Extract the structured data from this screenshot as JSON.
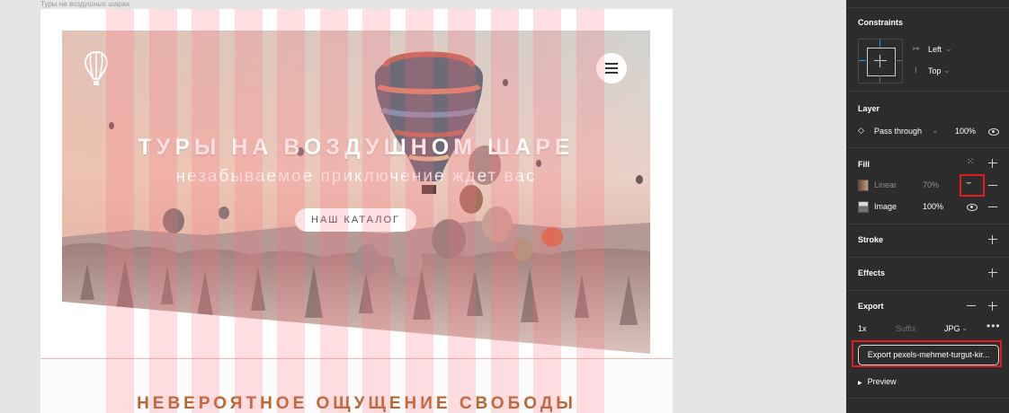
{
  "canvas": {
    "frame_label": "Туры на воздушных шарах",
    "hero": {
      "title": "ТУРЫ НА ВОЗДУШНОМ ШАРЕ",
      "subtitle": "незабываемое приключение ждет вас",
      "button_label": "НАШ КАТАЛОГ"
    },
    "section_title": "НЕВЕРОЯТНОЕ ОЩУЩЕНИЕ СВОБОДЫ",
    "grid_columns": 12
  },
  "panel": {
    "constraints": {
      "title": "Constraints",
      "horizontal": "Left",
      "vertical": "Top"
    },
    "layer": {
      "title": "Layer",
      "blend_mode": "Pass through",
      "opacity": "100%"
    },
    "fill": {
      "title": "Fill",
      "items": [
        {
          "type": "Linear",
          "opacity": "70%"
        },
        {
          "type": "Image",
          "opacity": "100%"
        }
      ]
    },
    "stroke": {
      "title": "Stroke"
    },
    "effects": {
      "title": "Effects"
    },
    "export": {
      "title": "Export",
      "scale": "1x",
      "suffix_placeholder": "Suffix",
      "format": "JPG",
      "button_label": "Export pexels-mehmet-turgut-kir...",
      "preview_label": "Preview"
    }
  },
  "colors": {
    "panel_bg": "#2c2c2c",
    "highlight": "#e11a1a",
    "grid_column": "#ff6e7d",
    "section_title": "#b9662f"
  }
}
